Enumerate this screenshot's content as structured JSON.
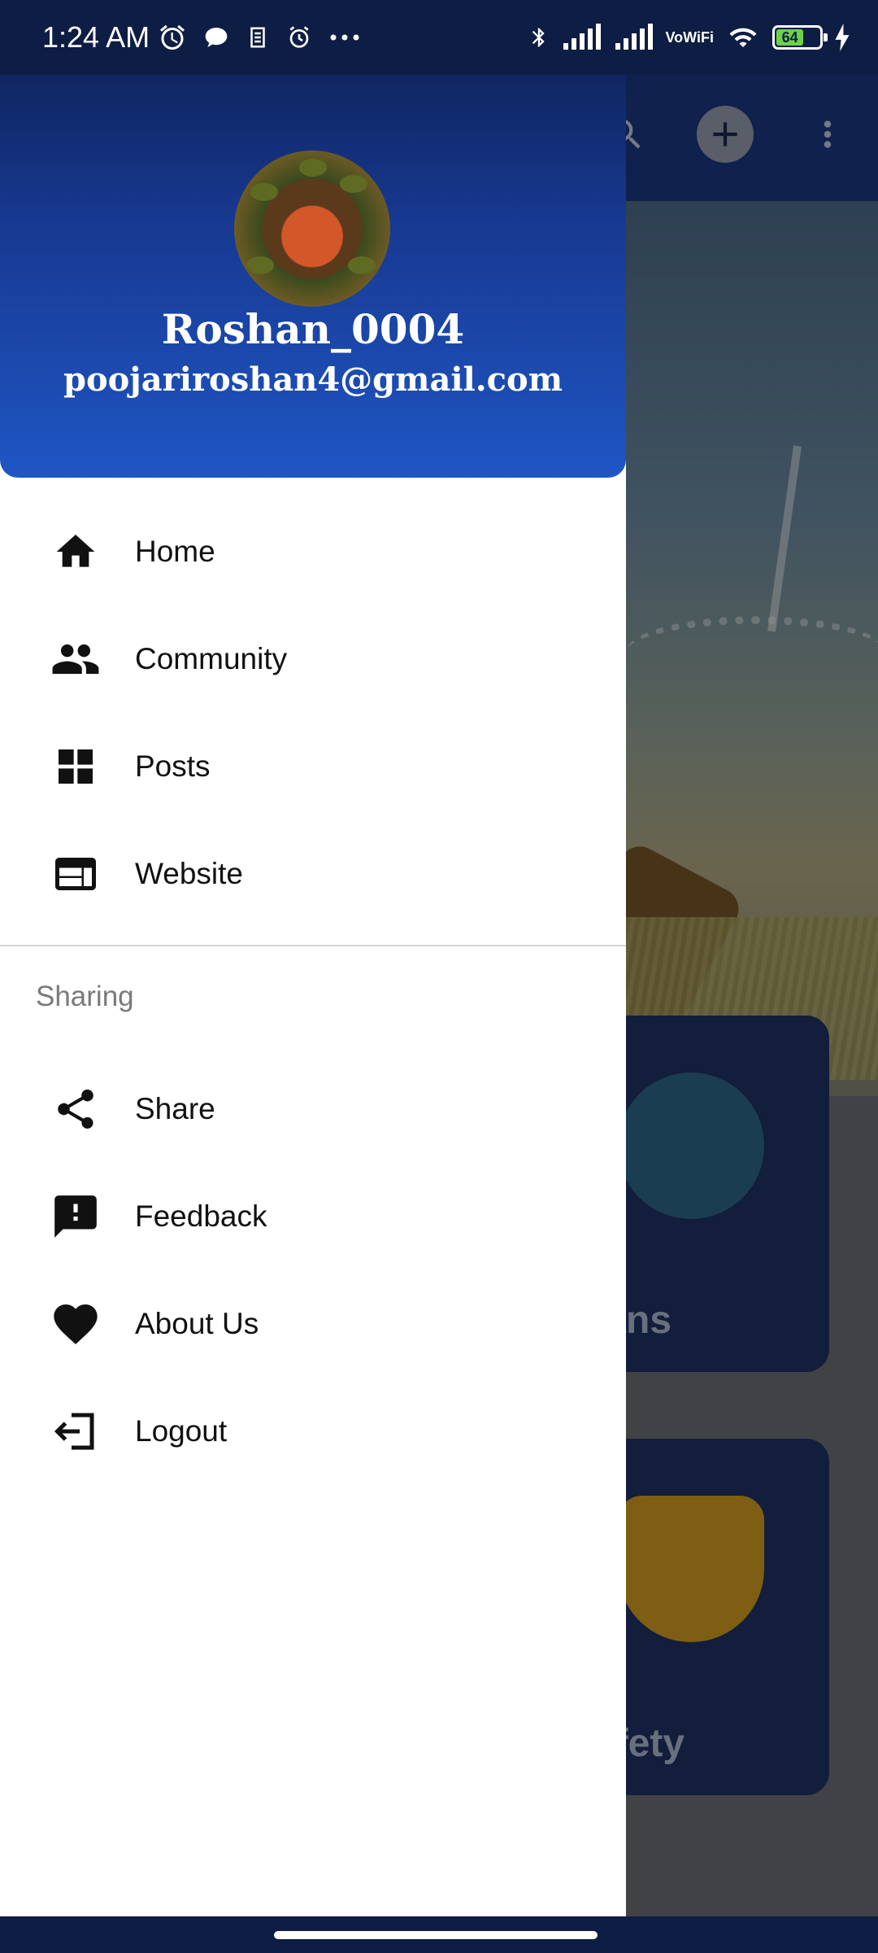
{
  "status_bar": {
    "time": "1:24 AM",
    "left_icons": [
      "alarm-icon",
      "chat-bubble-icon",
      "app-notification-icon",
      "alarm-clock-icon",
      "more-dots-icon"
    ],
    "right_icons": [
      "bluetooth-icon",
      "signal-icon",
      "signal-icon",
      "vowifi-icon",
      "wifi-icon",
      "battery-icon",
      "charging-icon"
    ],
    "vowifi_top": "Vo",
    "vowifi_bottom": "WiFi",
    "battery_level": "64"
  },
  "background_app": {
    "toolbar_actions": [
      "search-icon",
      "add-icon",
      "more-vert-icon"
    ],
    "cards": [
      {
        "label": "lans"
      },
      {
        "label": "afety"
      }
    ]
  },
  "drawer": {
    "header": {
      "name": "Roshan_0004",
      "email": "poojariroshan4@gmail.com"
    },
    "main_items": [
      {
        "label": "Home",
        "icon": "home-icon"
      },
      {
        "label": "Community",
        "icon": "people-icon"
      },
      {
        "label": "Posts",
        "icon": "dashboard-icon"
      },
      {
        "label": "Website",
        "icon": "web-icon"
      }
    ],
    "section_title": "Sharing",
    "sharing_items": [
      {
        "label": "Share",
        "icon": "share-icon"
      },
      {
        "label": "Feedback",
        "icon": "feedback-icon"
      },
      {
        "label": "About Us",
        "icon": "heart-icon"
      },
      {
        "label": "Logout",
        "icon": "logout-icon"
      }
    ]
  },
  "colors": {
    "header_top": "#0c1c4a",
    "header_bottom": "#1f56c4",
    "status_bar": "#0e1d43",
    "battery": "#6bd24a"
  }
}
